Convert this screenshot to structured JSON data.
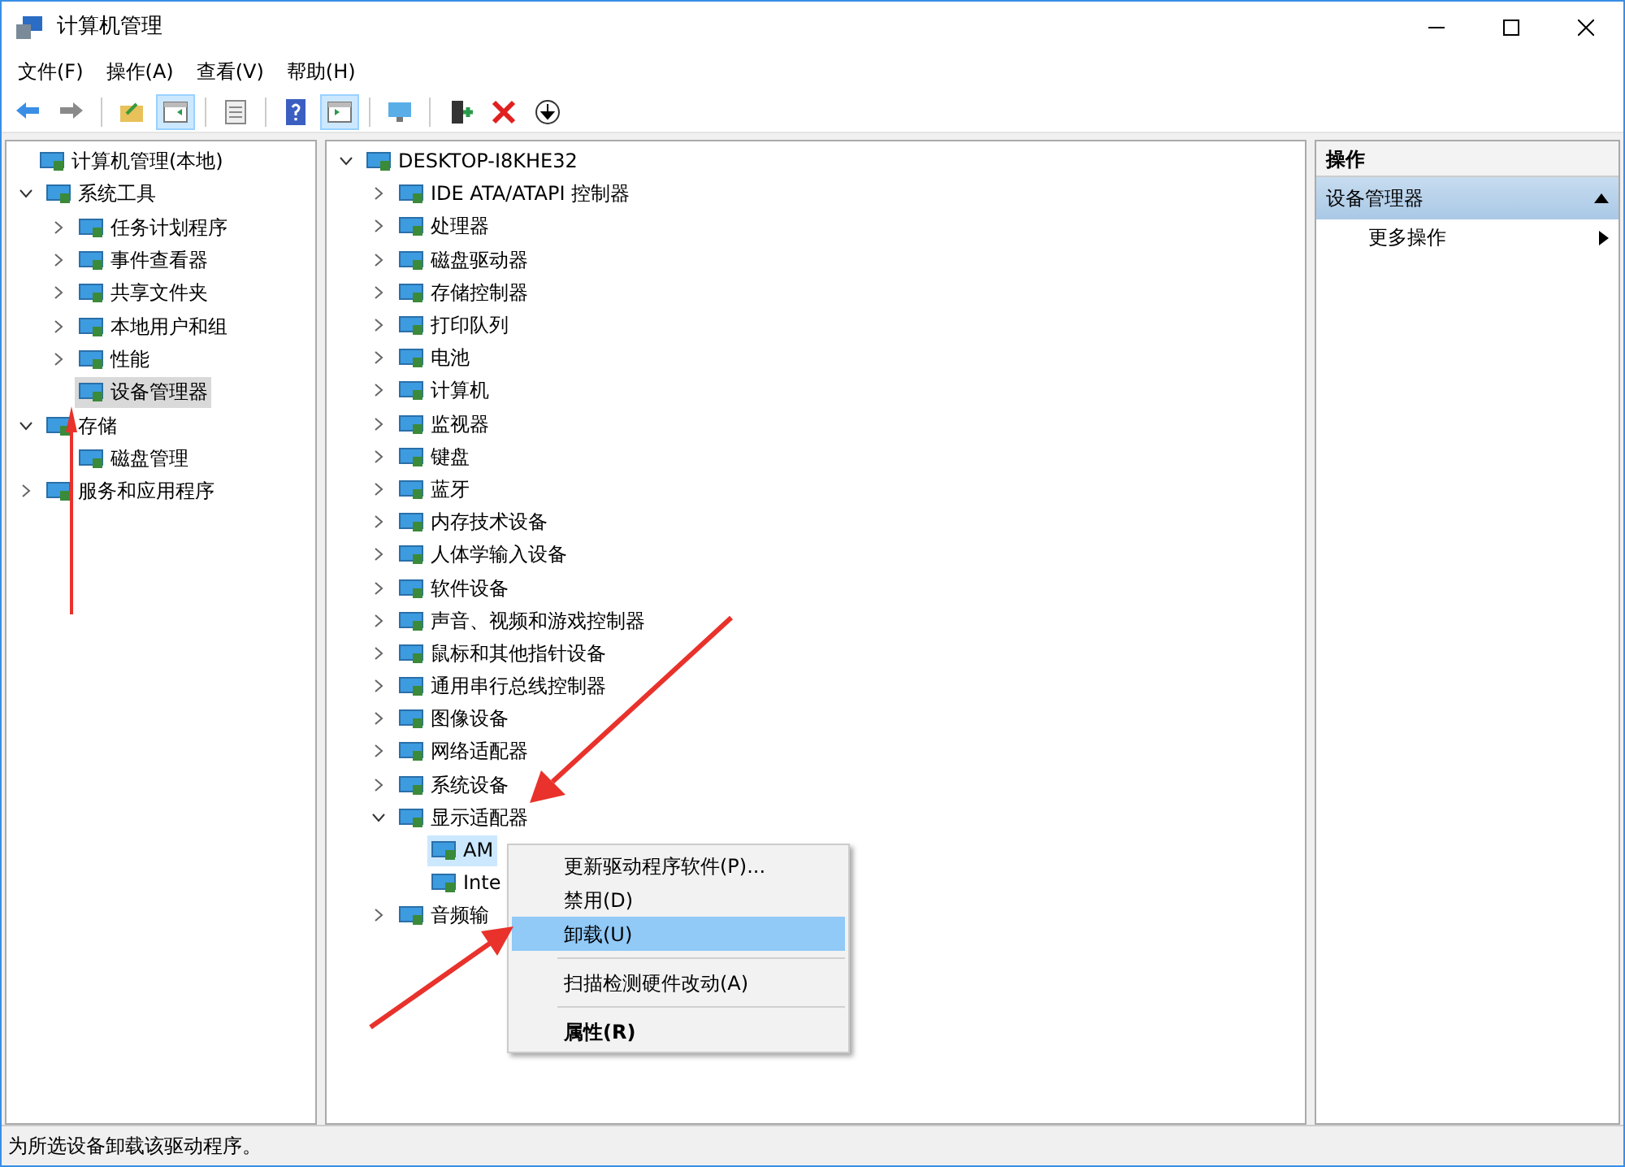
{
  "window": {
    "title": "计算机管理"
  },
  "menu": [
    "文件(F)",
    "操作(A)",
    "查看(V)",
    "帮助(H)"
  ],
  "toolbar": [
    {
      "kind": "button",
      "pressed": false
    },
    {
      "kind": "button",
      "pressed": false
    },
    {
      "kind": "separator"
    },
    {
      "kind": "button",
      "pressed": false
    },
    {
      "kind": "button",
      "pressed": true
    },
    {
      "kind": "separator"
    },
    {
      "kind": "button",
      "pressed": false
    },
    {
      "kind": "separator"
    },
    {
      "kind": "button",
      "pressed": false
    },
    {
      "kind": "button",
      "pressed": true
    },
    {
      "kind": "separator"
    },
    {
      "kind": "button",
      "pressed": false
    },
    {
      "kind": "separator"
    },
    {
      "kind": "button",
      "pressed": false
    },
    {
      "kind": "button",
      "pressed": false
    },
    {
      "kind": "button",
      "pressed": false
    }
  ],
  "console_tree": {
    "label": "计算机管理(本地)",
    "children": [
      {
        "label": "系统工具",
        "expanded": true,
        "selected": false,
        "children": [
          {
            "label": "任务计划程序",
            "expanded": false,
            "selected": false
          },
          {
            "label": "事件查看器",
            "expanded": false,
            "selected": false
          },
          {
            "label": "共享文件夹",
            "expanded": false,
            "selected": false
          },
          {
            "label": "本地用户和组",
            "expanded": false,
            "selected": false
          },
          {
            "label": "性能",
            "expanded": false,
            "selected": false
          },
          {
            "label": "设备管理器",
            "selected": true
          }
        ]
      },
      {
        "label": "存储",
        "expanded": true,
        "selected": false,
        "children": [
          {
            "label": "磁盘管理",
            "selected": false
          }
        ]
      },
      {
        "label": "服务和应用程序",
        "expanded": false,
        "selected": false
      }
    ]
  },
  "device_tree": {
    "label": "DESKTOP-I8KHE32",
    "children": [
      {
        "label": "IDE ATA/ATAPI 控制器",
        "expanded": false,
        "selected": false
      },
      {
        "label": "处理器",
        "expanded": false,
        "selected": false
      },
      {
        "label": "磁盘驱动器",
        "expanded": false,
        "selected": false
      },
      {
        "label": "存储控制器",
        "expanded": false,
        "selected": false
      },
      {
        "label": "打印队列",
        "expanded": false,
        "selected": false
      },
      {
        "label": "电池",
        "expanded": false,
        "selected": false
      },
      {
        "label": "计算机",
        "expanded": false,
        "selected": false
      },
      {
        "label": "监视器",
        "expanded": false,
        "selected": false
      },
      {
        "label": "键盘",
        "expanded": false,
        "selected": false
      },
      {
        "label": "蓝牙",
        "expanded": false,
        "selected": false
      },
      {
        "label": "内存技术设备",
        "expanded": false,
        "selected": false
      },
      {
        "label": "人体学输入设备",
        "expanded": false,
        "selected": false
      },
      {
        "label": "软件设备",
        "expanded": false,
        "selected": false
      },
      {
        "label": "声音、视频和游戏控制器",
        "expanded": false,
        "selected": false
      },
      {
        "label": "鼠标和其他指针设备",
        "expanded": false,
        "selected": false
      },
      {
        "label": "通用串行总线控制器",
        "expanded": false,
        "selected": false
      },
      {
        "label": "图像设备",
        "expanded": false,
        "selected": false
      },
      {
        "label": "网络适配器",
        "expanded": false,
        "selected": false
      },
      {
        "label": "系统设备",
        "expanded": false,
        "selected": false
      },
      {
        "label": "显示适配器",
        "expanded": true,
        "selected": false,
        "children": [
          {
            "label": "AM",
            "selected": true
          },
          {
            "label": "Inte",
            "selected": false
          }
        ]
      },
      {
        "label": "音频输",
        "expanded": false,
        "selected": false
      }
    ]
  },
  "context_menu": [
    {
      "kind": "item",
      "label": "更新驱动程序软件(P)...",
      "selected": false,
      "bold": false
    },
    {
      "kind": "item",
      "label": "禁用(D)",
      "selected": false,
      "bold": false
    },
    {
      "kind": "item",
      "label": "卸载(U)",
      "selected": true,
      "bold": false
    },
    {
      "kind": "separator"
    },
    {
      "kind": "item",
      "label": "扫描检测硬件改动(A)",
      "selected": false,
      "bold": false
    },
    {
      "kind": "separator"
    },
    {
      "kind": "item",
      "label": "属性(R)",
      "selected": false,
      "bold": true
    }
  ],
  "actions": {
    "header": "操作",
    "section": "设备管理器",
    "items": [
      "更多操作"
    ]
  },
  "status_bar": "为所选设备卸载该驱动程序。"
}
